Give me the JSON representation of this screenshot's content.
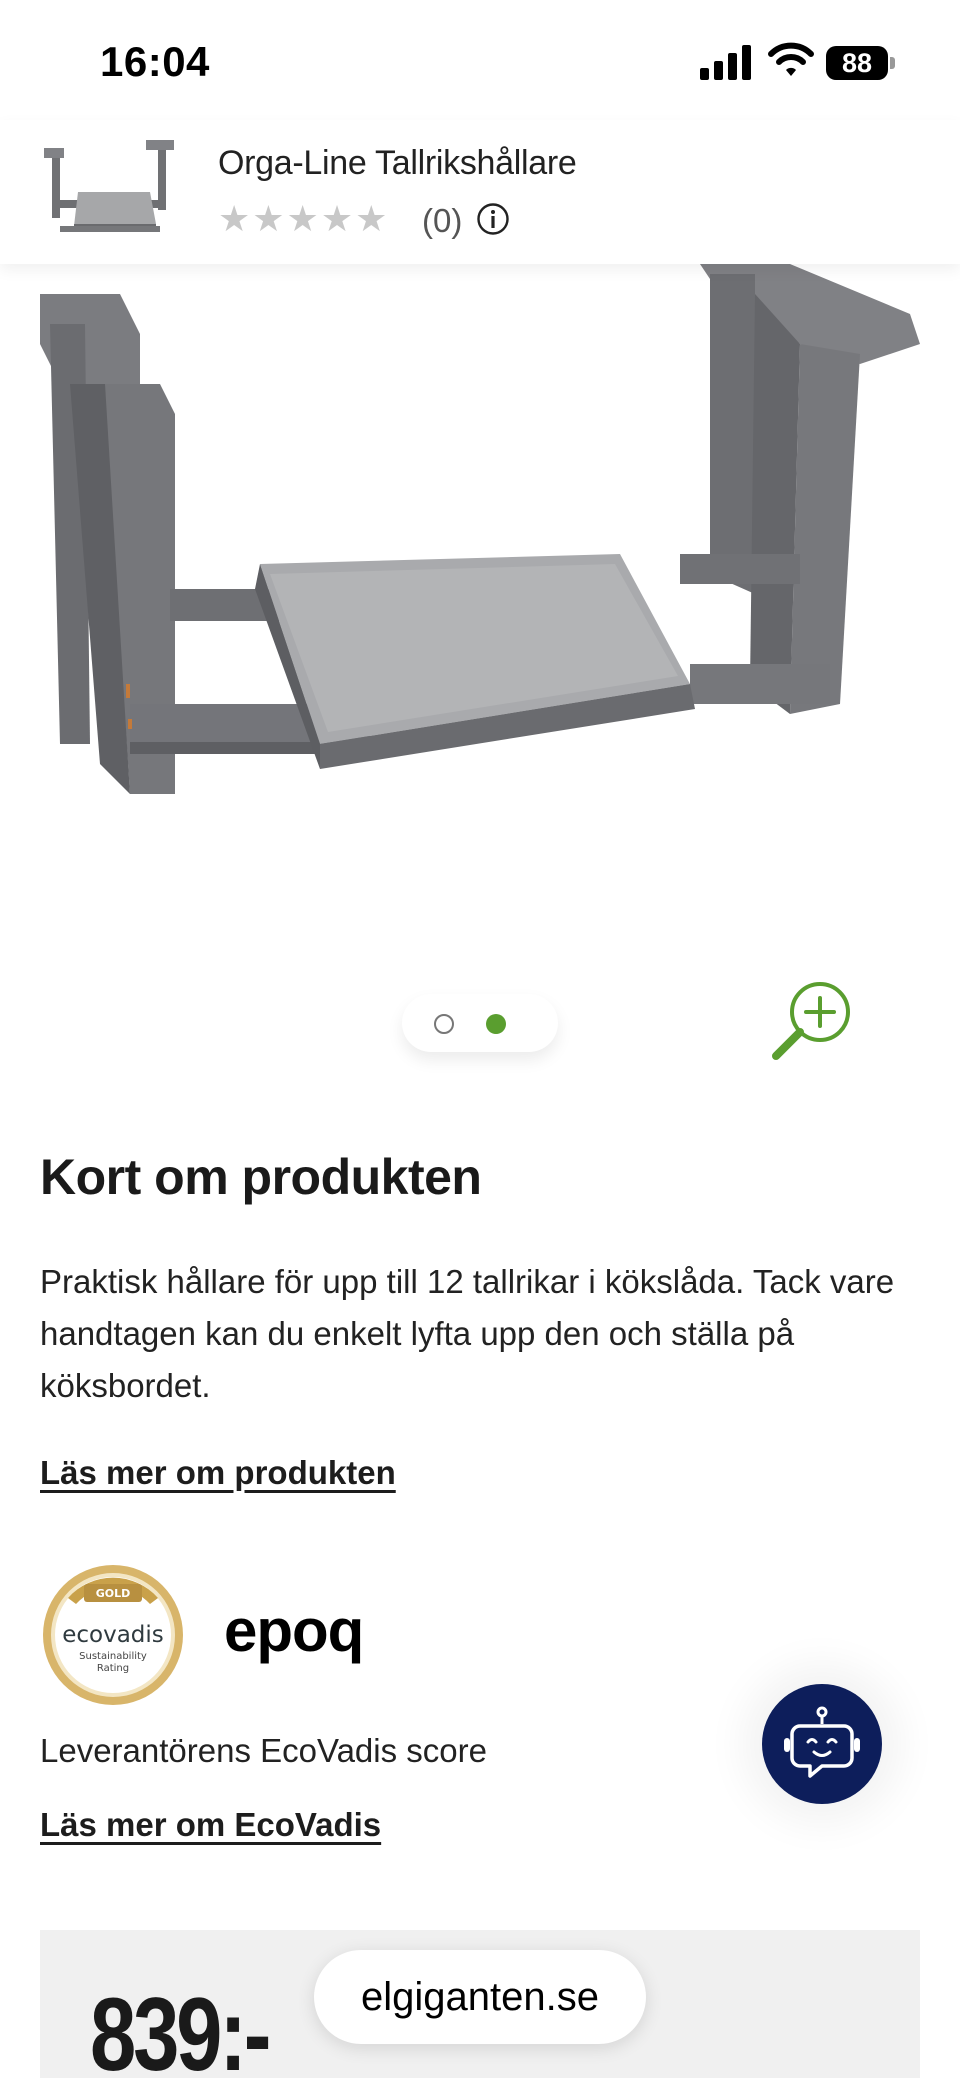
{
  "status_bar": {
    "time": "16:04",
    "battery": "88"
  },
  "product_header": {
    "title": "Orga-Line Tallrikshållare",
    "stars": "★★★★★",
    "rating_count": "(0)"
  },
  "gallery": {
    "image_count": 2,
    "active_index": 2
  },
  "summary": {
    "heading": "Kort om produkten",
    "description": "Praktisk hållare för upp till 12 tallrikar i kökslåda. Tack vare handtagen kan du enkelt lyfta upp den och ställa på köksbordet.",
    "read_more": "Läs mer om produkten"
  },
  "ecovadis": {
    "badge_top": "GOLD",
    "badge_name": "ecovadis",
    "badge_line1": "Sustainability",
    "badge_line2": "Rating",
    "supplier_logo": "epoq",
    "score_label": "Leverantörens EcoVadis score",
    "read_more": "Läs mer om EcoVadis"
  },
  "price": {
    "amount": "839:-"
  },
  "browser": {
    "url": "elgiganten.se"
  },
  "colors": {
    "accent_green": "#5a9e2f",
    "bot_navy": "#0d1e5b",
    "gold": "#c9a14a"
  }
}
